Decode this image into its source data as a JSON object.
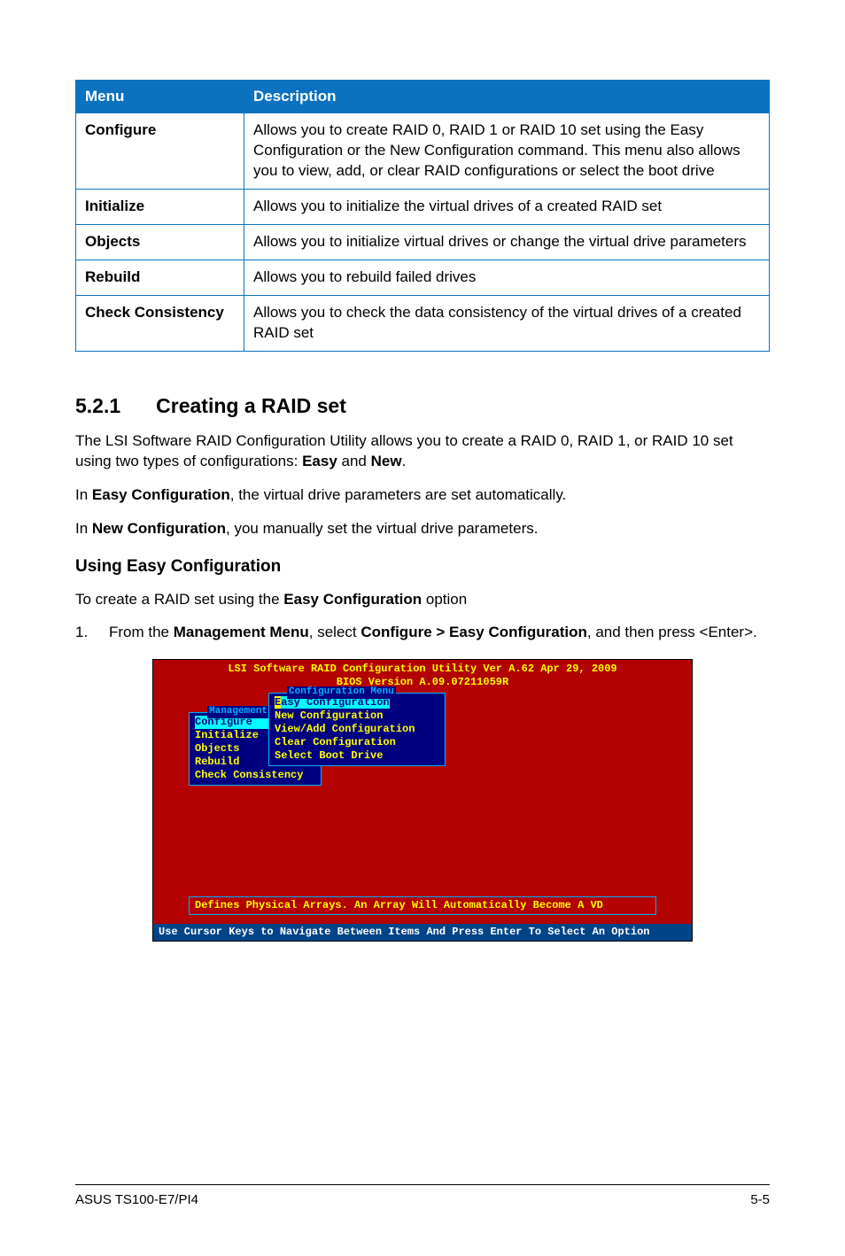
{
  "table": {
    "headers": [
      "Menu",
      "Description"
    ],
    "rows": [
      {
        "menu": "Configure",
        "desc": "Allows you to create RAID 0, RAID 1 or RAID 10 set using the Easy Configuration or the New Configuration command. This menu also allows you to view, add, or clear RAID configurations or select the boot drive"
      },
      {
        "menu": "Initialize",
        "desc": "Allows you to initialize the virtual drives of a created RAID set"
      },
      {
        "menu": "Objects",
        "desc": "Allows you to initialize virtual drives or change the virtual drive parameters"
      },
      {
        "menu": "Rebuild",
        "desc": "Allows you to rebuild failed drives"
      },
      {
        "menu": "Check Consistency",
        "desc": "Allows you to check the data consistency of the virtual drives of a created RAID set"
      }
    ]
  },
  "section": {
    "number": "5.2.1",
    "title": "Creating a RAID set"
  },
  "paragraphs": {
    "p1_a": "The LSI Software RAID Configuration Utility allows you to create a RAID 0, RAID 1, or RAID 10 set using two types of configurations: ",
    "p1_b": "Easy",
    "p1_c": " and ",
    "p1_d": "New",
    "p1_e": ".",
    "p2_a": "In ",
    "p2_b": "Easy Configuration",
    "p2_c": ", the virtual drive parameters are set automatically.",
    "p3_a": "In ",
    "p3_b": "New Configuration",
    "p3_c": ", you manually set the virtual drive parameters."
  },
  "subheading": "Using Easy Configuration",
  "sub_p1_a": "To create a RAID set using the ",
  "sub_p1_b": "Easy Configuration",
  "sub_p1_c": " option",
  "step": {
    "num": "1.",
    "t1": "From the ",
    "t2": "Management Menu",
    "t3": ", select ",
    "t4": "Configure > Easy Configuration",
    "t5": ", and then press <Enter>."
  },
  "bios": {
    "title": "LSI Software RAID Configuration Utility Ver A.62 Apr 29, 2009",
    "subtitle": "BIOS Version  A.09.07211059R",
    "mgmt_label": "Management",
    "mgmt_items": [
      "Configure",
      "Initialize",
      "Objects",
      "Rebuild",
      "Check Consistency"
    ],
    "config_label": "Configuration Menu",
    "config_items": {
      "sel_first": "E",
      "sel_rest": "asy Configuration",
      "i2": "New Configuration",
      "i3": "View/Add Configuration",
      "i4": "Clear Configuration",
      "i5": "Select Boot Drive"
    },
    "status": "Defines Physical Arrays. An Array Will Automatically Become A VD",
    "footer": "Use Cursor Keys to Navigate Between Items And Press Enter To Select An Option"
  },
  "page_footer": {
    "left": "ASUS TS100-E7/PI4",
    "right": "5-5"
  }
}
